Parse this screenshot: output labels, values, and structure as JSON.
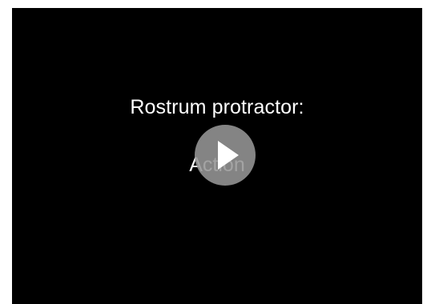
{
  "slide": {
    "heading": "Rostrum protractor:",
    "body": "Action"
  },
  "controls": {
    "play_icon": "play-icon"
  },
  "colors": {
    "background": "#000000",
    "text": "#ffffff",
    "play_button": "#969696"
  }
}
